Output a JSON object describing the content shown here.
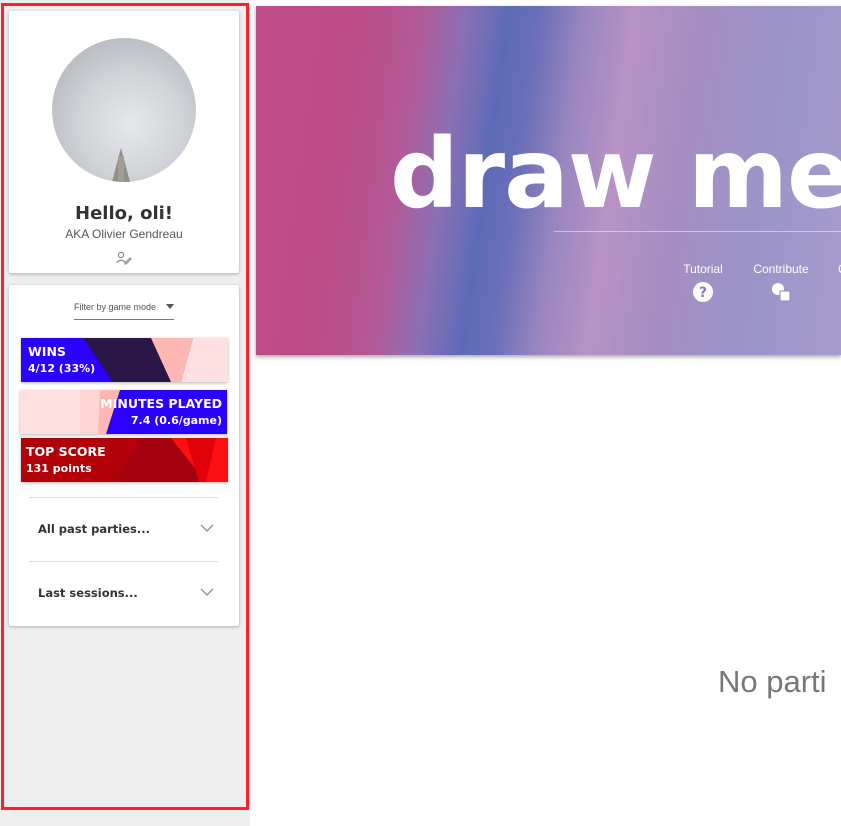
{
  "profile": {
    "greeting": "Hello, oli!",
    "aka": "AKA Olivier Gendreau"
  },
  "filter": {
    "placeholder": "Filter by game mode"
  },
  "stats": {
    "wins": {
      "label": "WINS",
      "value": "4/12 (33%)"
    },
    "minutes": {
      "label": "MINUTES PLAYED",
      "value": "7.4 (0.6/game)"
    },
    "top_score": {
      "label": "TOP SCORE",
      "value": "131 points"
    }
  },
  "accordions": {
    "past_parties": "All past parties...",
    "last_sessions": "Last sessions..."
  },
  "hero": {
    "title": "draw me s",
    "nav": {
      "tutorial": "Tutorial",
      "contribute": "Contribute",
      "partial": "C"
    }
  },
  "main": {
    "empty_text": "No parti"
  },
  "colors": {
    "accent_red": "#ff1f2d",
    "wins_blue": "#2b00ff",
    "top_score_red": "#d50000"
  },
  "icons": [
    "user-avatar-photo",
    "edit-profile-icon",
    "dropdown-caret-icon",
    "chevron-down-icon",
    "question-circle-icon",
    "shapes-icon"
  ]
}
